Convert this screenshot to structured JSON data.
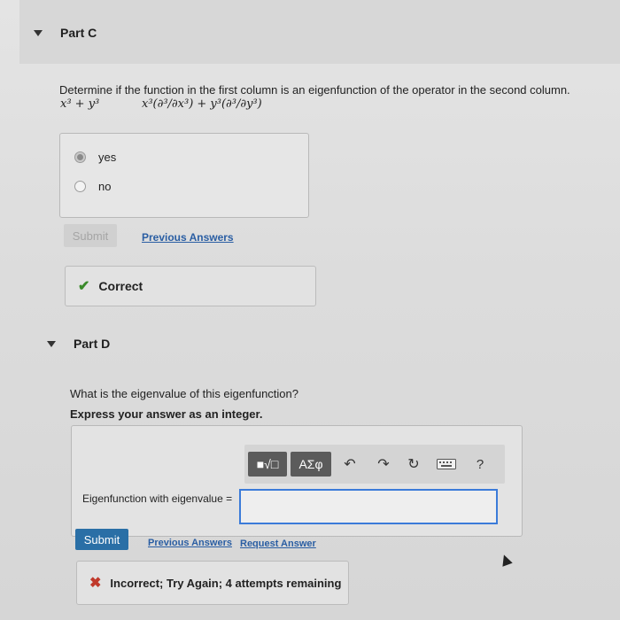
{
  "partC": {
    "title": "Part C",
    "question": "Determine if the function in the first column is an eigenfunction of the operator in the second column.",
    "function_expr": "x³ + y³",
    "operator_expr": "x³(∂³/∂x³) + y³(∂³/∂y³)",
    "options": [
      "yes",
      "no"
    ],
    "selected_option": "yes",
    "submit_label": "Submit",
    "previous_answers_label": "Previous Answers",
    "feedback": "Correct"
  },
  "partD": {
    "title": "Part D",
    "question": "What is the eigenvalue of this eigenfunction?",
    "instruction": "Express your answer as an integer.",
    "toolbar": {
      "templates_label": "■√□",
      "symbols_label": "ΑΣφ",
      "help_label": "?",
      "icons": [
        "undo-icon",
        "redo-icon",
        "reset-icon",
        "keyboard-icon",
        "help-icon"
      ]
    },
    "answer_label": "Eigenfunction with eigenvalue =",
    "answer_value": "",
    "submit_label": "Submit",
    "previous_answers_label": "Previous Answers",
    "request_answer_label": "Request Answer",
    "feedback": "Incorrect; Try Again; 4 attempts remaining"
  },
  "colors": {
    "link": "#2a5ea3",
    "submit_button": "#2a6fa6",
    "correct_check": "#3a8a2a",
    "incorrect_x": "#c0392b",
    "input_focus": "#3b7bd9"
  }
}
